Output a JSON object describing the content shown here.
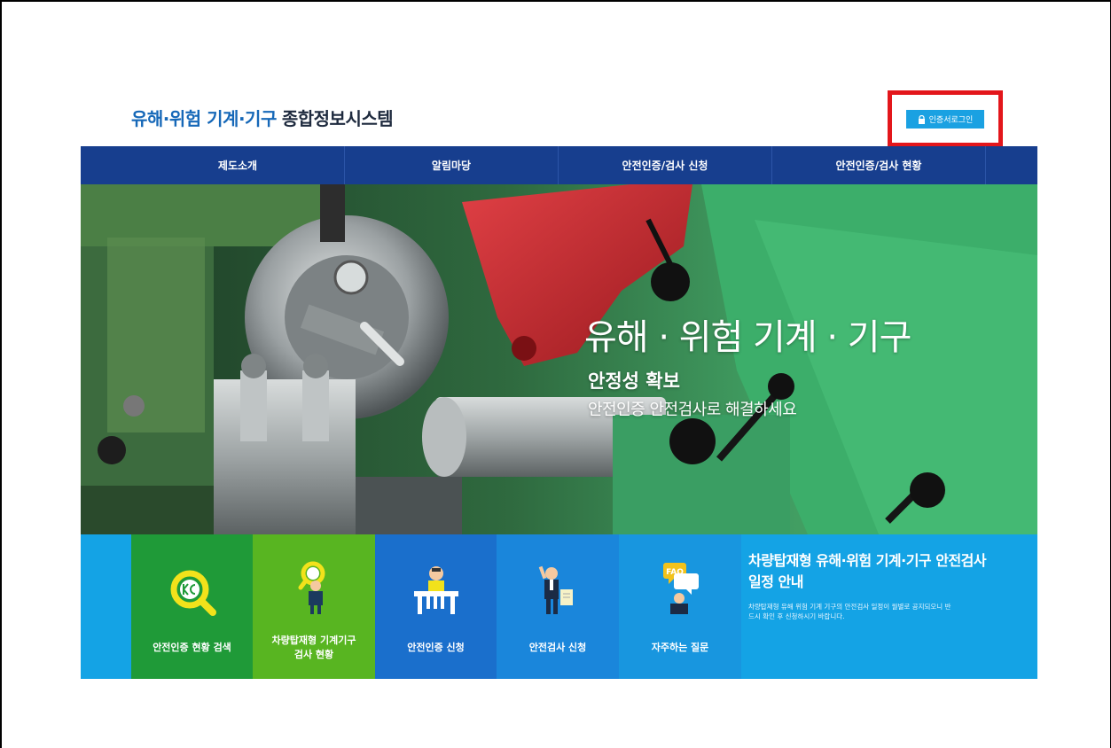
{
  "header": {
    "logo_part1": "유해·위험 기계·기구",
    "logo_part2": "종합정보시스템",
    "login_button": "인증서로그인"
  },
  "nav": {
    "items": [
      "제도소개",
      "알림마당",
      "안전인증/검사 신청",
      "안전인증/검사 현황"
    ]
  },
  "hero": {
    "title": "유해 · 위험  기계 · 기구",
    "subtitle": "안정성 확보",
    "tagline": "안전인증 안전검사로 해결하세요"
  },
  "tiles": [
    {
      "label": "안전인증 현황 검색",
      "icon": "kcs-search-icon",
      "color": "#1f9a38"
    },
    {
      "label": "차량탑재형 기계기구 검사 현황",
      "label_line1": "차량탑재형 기계기구",
      "label_line2": "검사 현황",
      "icon": "inspector-icon",
      "color": "#58b521"
    },
    {
      "label": "안전인증 신청",
      "icon": "desk-person-icon",
      "color": "#1a6fcc"
    },
    {
      "label": "안전검사 신청",
      "icon": "person-document-icon",
      "color": "#1a86db"
    },
    {
      "label": "자주하는 질문",
      "icon": "faq-icon",
      "color": "#1896df"
    }
  ],
  "notice": {
    "title": "차량탑재형 유해·위험 기계·기구 안전검사 일정 안내",
    "body": "차량탑재형 유해 위험 기계 기구의 안전검사 일정이 월별로 공지되오니 반드시 확인 후 신청하시기 바랍니다."
  },
  "colors": {
    "nav_bg": "#173e8e",
    "login_bg": "#1aa1e2",
    "highlight": "#e3161b",
    "tiles_bg": "#14a3e5"
  }
}
